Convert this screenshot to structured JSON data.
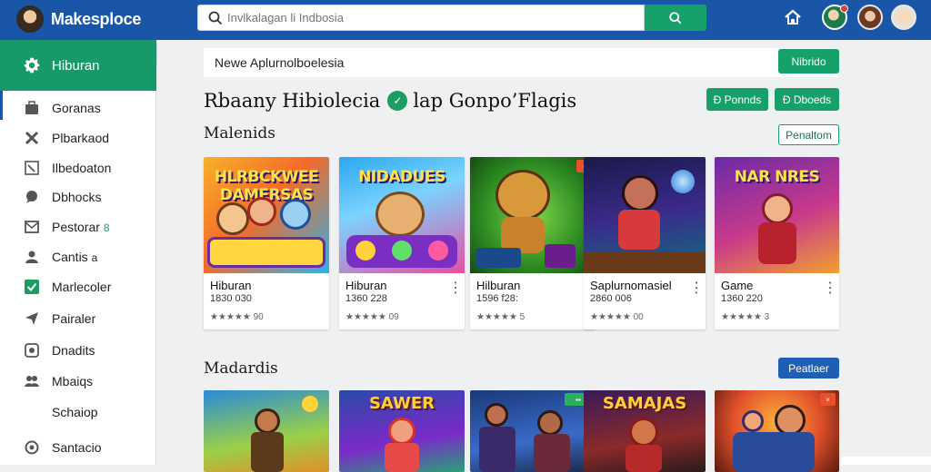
{
  "app": {
    "brand": "Makesploce",
    "search_placeholder": "Invlkalagan li Indbosia",
    "search_icon": "search-icon",
    "search_button_icon": "search-icon",
    "header_icons": [
      "home-icon",
      "avatar",
      "avatar",
      "avatar"
    ]
  },
  "sidebar": {
    "active": {
      "label": "Hiburan",
      "icon": "gear-icon"
    },
    "items": [
      {
        "label": "Goranas",
        "icon": "briefcase-icon"
      },
      {
        "label": "Plbarkaod",
        "icon": "tools-icon"
      },
      {
        "label": "Ilbedoaton",
        "icon": "chart-icon"
      },
      {
        "label": "Dbhocks",
        "icon": "chat-icon"
      },
      {
        "label": "Pestorar",
        "icon": "mail-icon",
        "suffix": "8"
      },
      {
        "label": "Cantis",
        "icon": "user-icon",
        "suffix": "a"
      },
      {
        "label": "Marlecoler",
        "icon": "check-icon"
      },
      {
        "label": "Pairaler",
        "icon": "send-icon"
      },
      {
        "label": "Dnadits",
        "icon": "camera-icon"
      },
      {
        "label": "Mbaiqs",
        "icon": "people-icon"
      },
      {
        "label": "Schaiop",
        "icon": ""
      },
      {
        "label": "Santacio",
        "icon": "support-icon"
      }
    ]
  },
  "notice": {
    "text": "Newe Aplurnolboelesia",
    "action_label": "Nibrido"
  },
  "page": {
    "title_left": "Rbaany Hibiolecia",
    "title_right": "lap Gonpo’Flagis",
    "btn_1": "Đ Ponnds",
    "btn_2": "Đ Dboeds"
  },
  "section1": {
    "title": "Malenids",
    "action": "Penaltom",
    "cards": [
      {
        "art": "HLRBCKWEE DAMERSAS",
        "name": "Hiburan",
        "meta": "1830 030",
        "rating": "★★★★★ 90"
      },
      {
        "art": "NIDADUES",
        "name": "Hiburan",
        "meta": "1360 228",
        "rating": "★★★★★ 09"
      },
      {
        "art": "",
        "name": "Hilburan",
        "meta": "1596 f28:",
        "rating": "★★★★★ 5"
      },
      {
        "art": "",
        "name": "Saplurnomasiel",
        "meta": "2860 006",
        "rating": "★★★★★ 00"
      },
      {
        "art": "NAR NRES",
        "name": "Game",
        "meta": "1360 220",
        "rating": "★★★★★ 3"
      }
    ]
  },
  "section2": {
    "title": "Madardis",
    "action": "Peatlaer",
    "cards": [
      {
        "art": ""
      },
      {
        "art": "SAWER"
      },
      {
        "art": ""
      },
      {
        "art": "SAMAJAS"
      },
      {
        "art": ""
      }
    ]
  },
  "colors": {
    "topbar": "#1a56a8",
    "accent_green": "#16a06a",
    "accent_blue": "#1f5fb3"
  }
}
